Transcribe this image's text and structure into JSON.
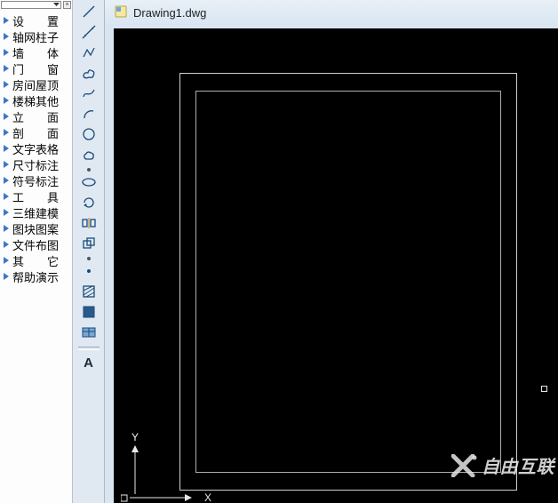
{
  "menu": {
    "items": [
      {
        "label": "设　　置",
        "name": "menu-settings"
      },
      {
        "label": "轴网柱子",
        "name": "menu-axis-grid"
      },
      {
        "label": "墙　　体",
        "name": "menu-walls"
      },
      {
        "label": "门　　窗",
        "name": "menu-doors-windows"
      },
      {
        "label": "房间屋顶",
        "name": "menu-room-roof"
      },
      {
        "label": "楼梯其他",
        "name": "menu-stairs-other"
      },
      {
        "label": "立　　面",
        "name": "menu-elevation"
      },
      {
        "label": "剖　　面",
        "name": "menu-section"
      },
      {
        "label": "文字表格",
        "name": "menu-text-table"
      },
      {
        "label": "尺寸标注",
        "name": "menu-dimension"
      },
      {
        "label": "符号标注",
        "name": "menu-symbol"
      },
      {
        "label": "工　　具",
        "name": "menu-tools"
      },
      {
        "label": "三维建模",
        "name": "menu-3d-modeling"
      },
      {
        "label": "图块图案",
        "name": "menu-blocks-patterns"
      },
      {
        "label": "文件布图",
        "name": "menu-file-layout"
      },
      {
        "label": "其　　它",
        "name": "menu-other"
      },
      {
        "label": "帮助演示",
        "name": "menu-help-demo"
      }
    ]
  },
  "titlebar": {
    "filename": "Drawing1.dwg"
  },
  "axes": {
    "y_label": "Y"
  },
  "watermark": {
    "text": "自由互联"
  },
  "tools": [
    {
      "name": "line-tool",
      "icon": "line"
    },
    {
      "name": "construction-line-tool",
      "icon": "xline"
    },
    {
      "name": "polyline-tool",
      "icon": "pline"
    },
    {
      "name": "revcloud-tool",
      "icon": "revcloud"
    },
    {
      "name": "spline-tool",
      "icon": "spline"
    },
    {
      "name": "arc-tool",
      "icon": "arc"
    },
    {
      "name": "circle-tool",
      "icon": "circle"
    },
    {
      "name": "cloud-tool",
      "icon": "cloud"
    },
    {
      "name": "sep1",
      "icon": "sep"
    },
    {
      "name": "ellipse-tool",
      "icon": "ellipse"
    },
    {
      "name": "rotate-tool",
      "icon": "rotate"
    },
    {
      "name": "mirror-tool",
      "icon": "mirror"
    },
    {
      "name": "copy-tool",
      "icon": "copy"
    },
    {
      "name": "sep2",
      "icon": "sep"
    },
    {
      "name": "point-tool",
      "icon": "dot"
    },
    {
      "name": "hatch-tool",
      "icon": "hatch"
    },
    {
      "name": "region-tool",
      "icon": "region"
    },
    {
      "name": "table-tool",
      "icon": "table"
    },
    {
      "name": "divider",
      "icon": "divider"
    },
    {
      "name": "text-tool",
      "icon": "text"
    }
  ],
  "text_tool_label": "A"
}
